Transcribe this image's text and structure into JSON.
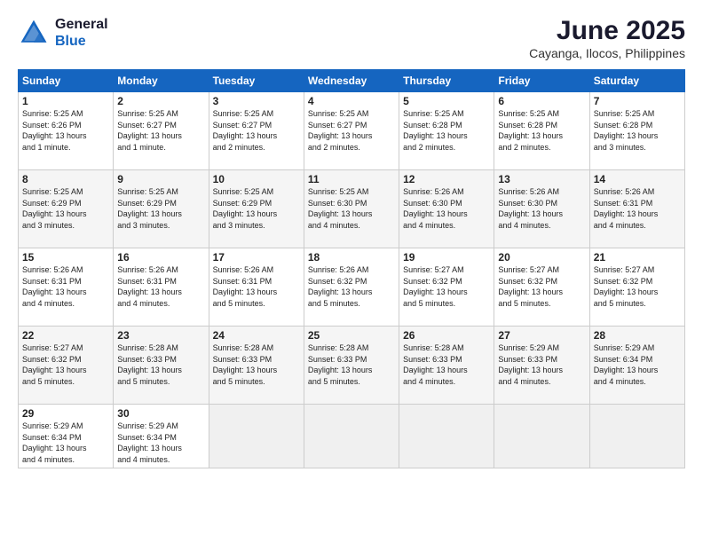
{
  "app": {
    "name": "GeneralBlue",
    "logo_text_line1": "General",
    "logo_text_line2": "Blue"
  },
  "header": {
    "month_year": "June 2025",
    "location": "Cayanga, Ilocos, Philippines"
  },
  "weekdays": [
    "Sunday",
    "Monday",
    "Tuesday",
    "Wednesday",
    "Thursday",
    "Friday",
    "Saturday"
  ],
  "weeks": [
    [
      {
        "day": 1,
        "info": "Sunrise: 5:25 AM\nSunset: 6:26 PM\nDaylight: 13 hours\nand 1 minute."
      },
      {
        "day": 2,
        "info": "Sunrise: 5:25 AM\nSunset: 6:27 PM\nDaylight: 13 hours\nand 1 minute."
      },
      {
        "day": 3,
        "info": "Sunrise: 5:25 AM\nSunset: 6:27 PM\nDaylight: 13 hours\nand 2 minutes."
      },
      {
        "day": 4,
        "info": "Sunrise: 5:25 AM\nSunset: 6:27 PM\nDaylight: 13 hours\nand 2 minutes."
      },
      {
        "day": 5,
        "info": "Sunrise: 5:25 AM\nSunset: 6:28 PM\nDaylight: 13 hours\nand 2 minutes."
      },
      {
        "day": 6,
        "info": "Sunrise: 5:25 AM\nSunset: 6:28 PM\nDaylight: 13 hours\nand 2 minutes."
      },
      {
        "day": 7,
        "info": "Sunrise: 5:25 AM\nSunset: 6:28 PM\nDaylight: 13 hours\nand 3 minutes."
      }
    ],
    [
      {
        "day": 8,
        "info": "Sunrise: 5:25 AM\nSunset: 6:29 PM\nDaylight: 13 hours\nand 3 minutes."
      },
      {
        "day": 9,
        "info": "Sunrise: 5:25 AM\nSunset: 6:29 PM\nDaylight: 13 hours\nand 3 minutes."
      },
      {
        "day": 10,
        "info": "Sunrise: 5:25 AM\nSunset: 6:29 PM\nDaylight: 13 hours\nand 3 minutes."
      },
      {
        "day": 11,
        "info": "Sunrise: 5:25 AM\nSunset: 6:30 PM\nDaylight: 13 hours\nand 4 minutes."
      },
      {
        "day": 12,
        "info": "Sunrise: 5:26 AM\nSunset: 6:30 PM\nDaylight: 13 hours\nand 4 minutes."
      },
      {
        "day": 13,
        "info": "Sunrise: 5:26 AM\nSunset: 6:30 PM\nDaylight: 13 hours\nand 4 minutes."
      },
      {
        "day": 14,
        "info": "Sunrise: 5:26 AM\nSunset: 6:31 PM\nDaylight: 13 hours\nand 4 minutes."
      }
    ],
    [
      {
        "day": 15,
        "info": "Sunrise: 5:26 AM\nSunset: 6:31 PM\nDaylight: 13 hours\nand 4 minutes."
      },
      {
        "day": 16,
        "info": "Sunrise: 5:26 AM\nSunset: 6:31 PM\nDaylight: 13 hours\nand 4 minutes."
      },
      {
        "day": 17,
        "info": "Sunrise: 5:26 AM\nSunset: 6:31 PM\nDaylight: 13 hours\nand 5 minutes."
      },
      {
        "day": 18,
        "info": "Sunrise: 5:26 AM\nSunset: 6:32 PM\nDaylight: 13 hours\nand 5 minutes."
      },
      {
        "day": 19,
        "info": "Sunrise: 5:27 AM\nSunset: 6:32 PM\nDaylight: 13 hours\nand 5 minutes."
      },
      {
        "day": 20,
        "info": "Sunrise: 5:27 AM\nSunset: 6:32 PM\nDaylight: 13 hours\nand 5 minutes."
      },
      {
        "day": 21,
        "info": "Sunrise: 5:27 AM\nSunset: 6:32 PM\nDaylight: 13 hours\nand 5 minutes."
      }
    ],
    [
      {
        "day": 22,
        "info": "Sunrise: 5:27 AM\nSunset: 6:32 PM\nDaylight: 13 hours\nand 5 minutes."
      },
      {
        "day": 23,
        "info": "Sunrise: 5:28 AM\nSunset: 6:33 PM\nDaylight: 13 hours\nand 5 minutes."
      },
      {
        "day": 24,
        "info": "Sunrise: 5:28 AM\nSunset: 6:33 PM\nDaylight: 13 hours\nand 5 minutes."
      },
      {
        "day": 25,
        "info": "Sunrise: 5:28 AM\nSunset: 6:33 PM\nDaylight: 13 hours\nand 5 minutes."
      },
      {
        "day": 26,
        "info": "Sunrise: 5:28 AM\nSunset: 6:33 PM\nDaylight: 13 hours\nand 4 minutes."
      },
      {
        "day": 27,
        "info": "Sunrise: 5:29 AM\nSunset: 6:33 PM\nDaylight: 13 hours\nand 4 minutes."
      },
      {
        "day": 28,
        "info": "Sunrise: 5:29 AM\nSunset: 6:34 PM\nDaylight: 13 hours\nand 4 minutes."
      }
    ],
    [
      {
        "day": 29,
        "info": "Sunrise: 5:29 AM\nSunset: 6:34 PM\nDaylight: 13 hours\nand 4 minutes."
      },
      {
        "day": 30,
        "info": "Sunrise: 5:29 AM\nSunset: 6:34 PM\nDaylight: 13 hours\nand 4 minutes."
      },
      null,
      null,
      null,
      null,
      null
    ]
  ]
}
